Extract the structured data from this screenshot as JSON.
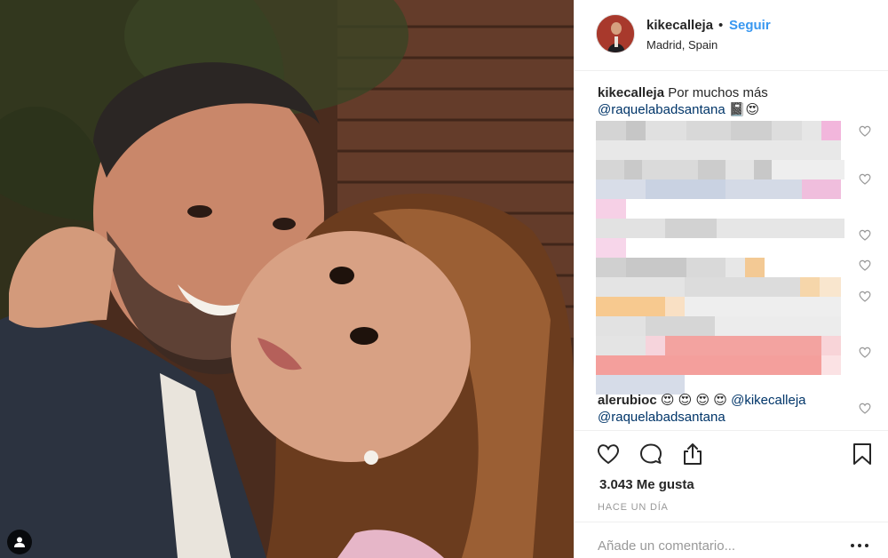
{
  "post": {
    "photo_alt": "",
    "author": {
      "username": "kikecalleja",
      "location": "Madrid, Spain",
      "dot": "•",
      "follow_label": "Seguir"
    },
    "caption": {
      "username": "kikecalleja",
      "text": "Por muchos más",
      "mention": "@raquelabadsantana",
      "emoji": "📓😍"
    },
    "comments": [
      {
        "username": "alerubioc",
        "emoji": "😍 😍 😍 😍",
        "mention1": "@kikecalleja",
        "mention2": "@raquelabadsantana"
      }
    ],
    "likes": "3.043 Me gusta",
    "time_ago": "HACE UN DÍA",
    "add_comment_placeholder": "Añade un comentario..."
  },
  "colors": {
    "link": "#3897f0",
    "mention": "#003569",
    "border": "#efefef",
    "muted": "#999999"
  },
  "icons": [
    "user-tag-icon",
    "heart-icon",
    "comment-icon",
    "share-icon",
    "bookmark-icon",
    "more-options-icon",
    "small-heart-icon"
  ]
}
